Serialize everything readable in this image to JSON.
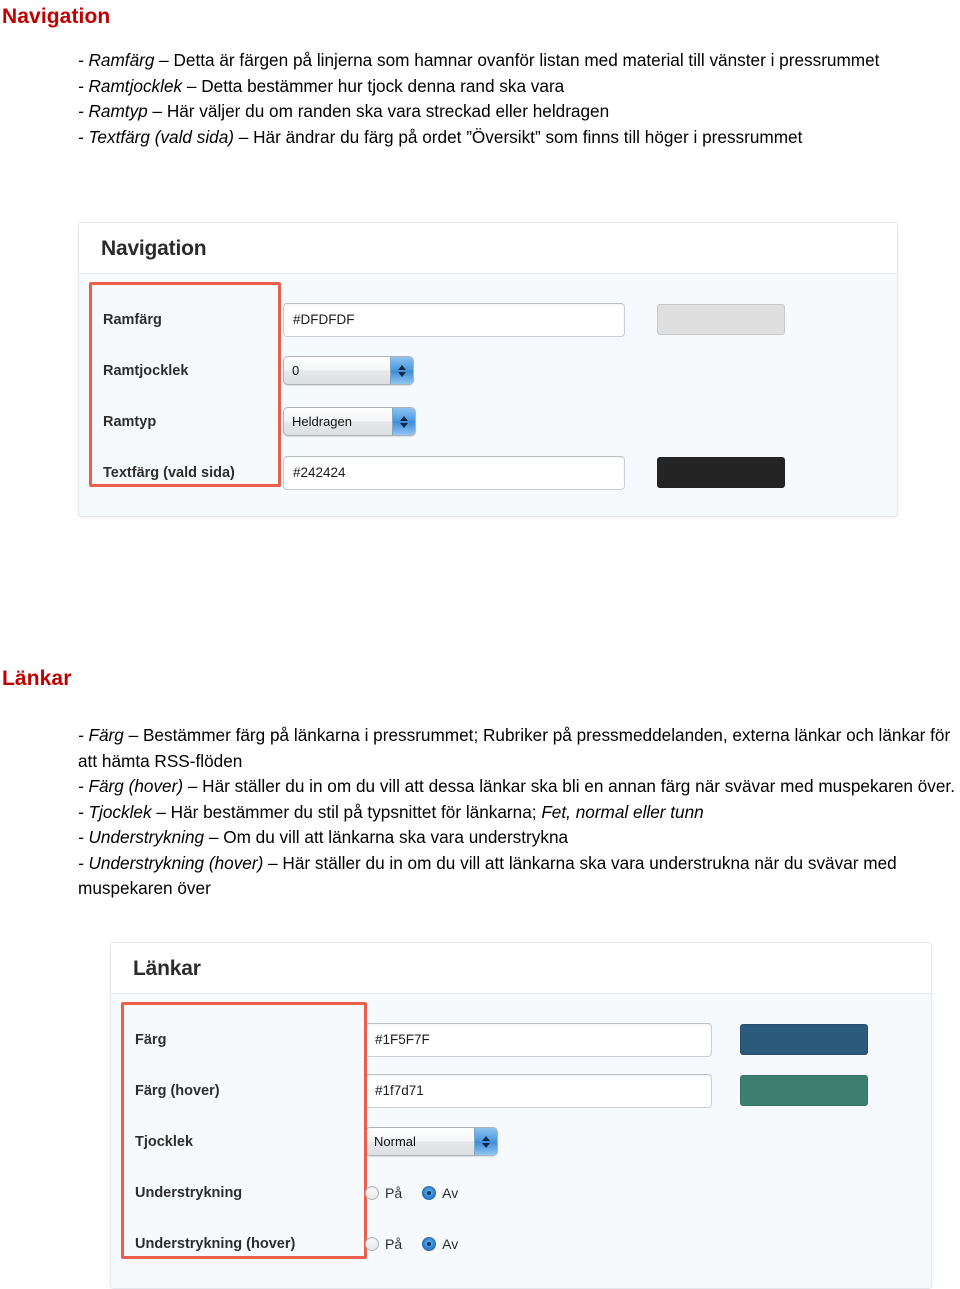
{
  "document": {
    "sections": [
      {
        "heading": "Navigation",
        "heading_color": "#C00000",
        "paragraph_lines": [
          {
            "term": "- Ramfärg",
            "rest": " – Detta är färgen på linjerna som hamnar ovanför listan med material till vänster i pressrummet"
          },
          {
            "term": "- Ramtjocklek",
            "rest": " – Detta bestämmer hur tjock denna rand ska vara"
          },
          {
            "term": "- Ramtyp",
            "rest": " – Här väljer du om randen ska vara streckad eller heldragen"
          },
          {
            "term": "- Textfärg (vald sida)",
            "rest": " – Här ändrar du färg på ordet ”Översikt” som finns till höger i pressrummet"
          }
        ]
      },
      {
        "heading": "Länkar",
        "heading_color": "#C00000",
        "paragraph_lines": [
          {
            "term": "- Färg",
            "rest": " – Bestämmer färg på länkarna i pressrummet; Rubriker på pressmeddelanden, externa länkar och länkar för att hämta RSS-flöden"
          },
          {
            "term": "- Färg (hover)",
            "rest": " – Här ställer du in om du vill att dessa länkar ska bli en annan färg när svävar med muspekaren över."
          },
          {
            "term": "- Tjocklek",
            "rest": " – Här bestämmer du stil på typsnittet för länkarna; ",
            "trailing_italic": "Fet, normal eller tunn"
          },
          {
            "term": "- Understrykning",
            "rest": " – Om du vill att länkarna ska vara understrykna"
          },
          {
            "term": "- Understrykning (hover)",
            "rest": " – Här ställer du in om du vill att länkarna ska vara understrukna när du svävar med muspekaren över"
          }
        ]
      }
    ]
  },
  "panel_navigation": {
    "title": "Navigation",
    "rows": [
      {
        "label": "Ramfärg",
        "control": "color",
        "value": "#DFDFDF",
        "swatch_color": "#dfdfdf"
      },
      {
        "label": "Ramtjocklek",
        "control": "stepper",
        "value": "0"
      },
      {
        "label": "Ramtyp",
        "control": "popup",
        "value": "Heldragen"
      },
      {
        "label": "Textfärg (vald sida)",
        "control": "color",
        "value": "#242424",
        "swatch_color": "#242424"
      }
    ]
  },
  "panel_lankar": {
    "title": "Länkar",
    "rows": [
      {
        "label": "Färg",
        "control": "color",
        "value": "#1F5F7F",
        "swatch_color": "#2b5a7a"
      },
      {
        "label": "Färg (hover)",
        "control": "color",
        "value": "#1f7d71",
        "swatch_color": "#3d7f6e"
      },
      {
        "label": "Tjocklek",
        "control": "popup",
        "value": "Normal"
      },
      {
        "label": "Understrykning",
        "control": "radio",
        "options": [
          {
            "label": "På",
            "checked": false
          },
          {
            "label": "Av",
            "checked": true
          }
        ]
      },
      {
        "label": "Understrykning (hover)",
        "control": "radio",
        "options": [
          {
            "label": "På",
            "checked": false
          },
          {
            "label": "Av",
            "checked": true
          }
        ]
      }
    ]
  },
  "annotation": {
    "highlight_border_color": "#e8604c"
  }
}
